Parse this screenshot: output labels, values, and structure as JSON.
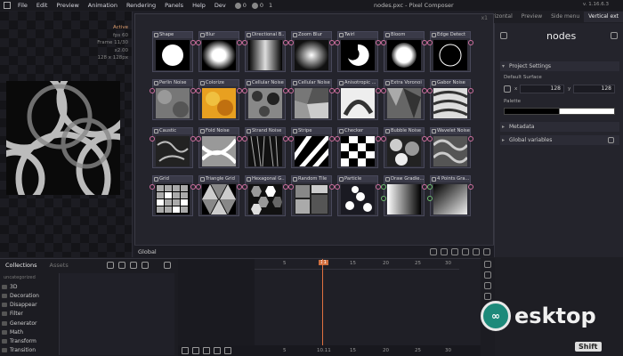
{
  "menubar": {
    "items": [
      "File",
      "Edit",
      "Preview",
      "Animation",
      "Rendering",
      "Panels",
      "Help",
      "Dev"
    ],
    "stats": [
      "0",
      "0",
      "1"
    ],
    "title": "nodes.pxc - Pixel Composer",
    "version": "v. 1.16.6.3"
  },
  "tabs": [
    "Horizontal",
    "Preview",
    "Side menu",
    "Vertical ext"
  ],
  "preview": {
    "active_label": "Active",
    "fps": "fps 60",
    "frame": "Frame 11/30",
    "zoom": "x2.00",
    "size": "128 x 128px"
  },
  "graph": {
    "corner_number": "x1",
    "footer_label": "Global",
    "nodes": [
      {
        "label": "Shape"
      },
      {
        "label": "Blur"
      },
      {
        "label": "Directional B..."
      },
      {
        "label": "Zoom Blur"
      },
      {
        "label": "Twirl"
      },
      {
        "label": "Bloom"
      },
      {
        "label": "Edge Detect"
      },
      {
        "label": "Perlin Noise"
      },
      {
        "label": "Colorize"
      },
      {
        "label": "Cellular Noise"
      },
      {
        "label": "Cellular Noise"
      },
      {
        "label": "Anisotropic ..."
      },
      {
        "label": "Extra Voronoi"
      },
      {
        "label": "Gabor Noise"
      },
      {
        "label": "Caustic"
      },
      {
        "label": "Fold Noise"
      },
      {
        "label": "Strand Noise"
      },
      {
        "label": "Stripe"
      },
      {
        "label": "Checker"
      },
      {
        "label": "Bubble Noise"
      },
      {
        "label": "Wavelet Noise"
      },
      {
        "label": "Grid"
      },
      {
        "label": "Triangle Grid"
      },
      {
        "label": "Hexagonal G..."
      },
      {
        "label": "Random Tile"
      },
      {
        "label": "Particle"
      },
      {
        "label": "Draw Gradie..."
      },
      {
        "label": "4 Points Gra..."
      }
    ]
  },
  "inspector": {
    "title": "nodes",
    "project_settings": "Project Settings",
    "default_surface": "Default Surface",
    "x_label": "x",
    "x_value": "128",
    "y_label": "y",
    "y_value": "128",
    "palette": "Palette",
    "metadata": "Metadata",
    "global_variables": "Global variables"
  },
  "collections": {
    "tab_collections": "Collections",
    "tab_assets": "Assets",
    "uncategorized": "uncategorized",
    "items": [
      "3D",
      "Decoration",
      "Disappear",
      "Filter",
      "Generator",
      "Math",
      "Transform",
      "Transition"
    ]
  },
  "timeline": {
    "ticks_top": [
      "5",
      "10",
      "15",
      "20",
      "25",
      "30"
    ],
    "current_frame": "11",
    "ticks_bottom": [
      "5",
      "10",
      "15",
      "20",
      "25",
      "30"
    ],
    "current_frame_bottom": "10.11"
  },
  "watermark": {
    "text": "esktop",
    "badge": "Shift"
  }
}
